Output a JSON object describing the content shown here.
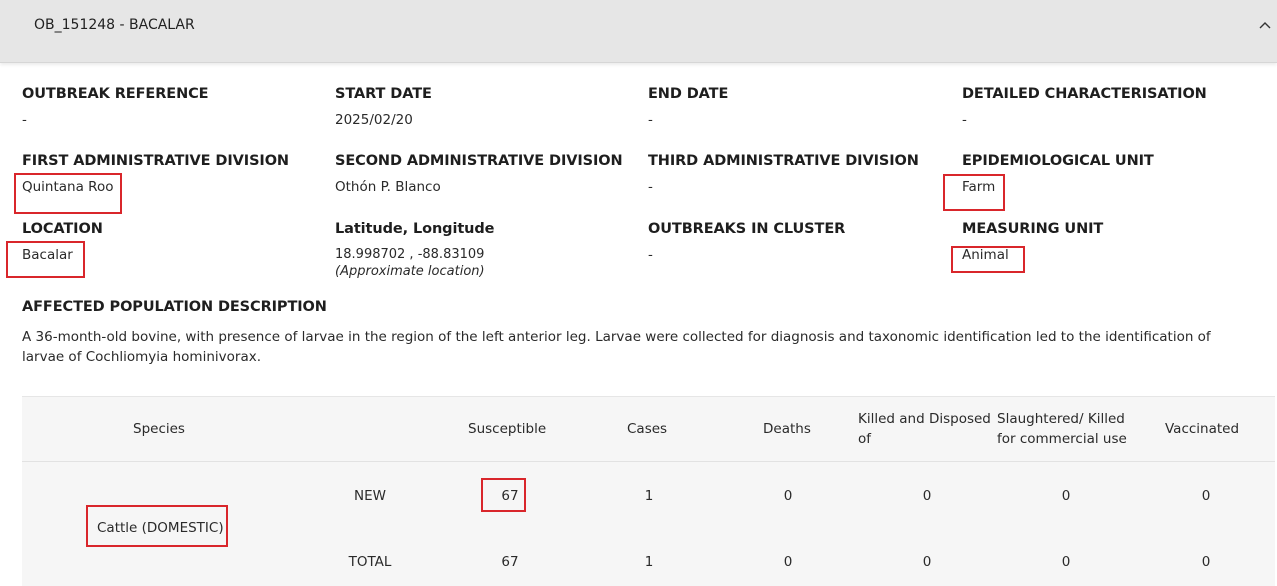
{
  "header": {
    "title": "OB_151248 - BACALAR",
    "toggle_icon": "chevron-up-icon"
  },
  "fields": {
    "outbreak_reference": {
      "label": "OUTBREAK REFERENCE",
      "value": "-"
    },
    "start_date": {
      "label": "START DATE",
      "value": "2025/02/20"
    },
    "end_date": {
      "label": "END DATE",
      "value": "-"
    },
    "detailed_characterisation": {
      "label": "DETAILED CHARACTERISATION",
      "value": "-"
    },
    "first_admin_division": {
      "label": "FIRST ADMINISTRATIVE DIVISION",
      "value": "Quintana Roo"
    },
    "second_admin_division": {
      "label": "SECOND ADMINISTRATIVE DIVISION",
      "value": "Othón P. Blanco"
    },
    "third_admin_division": {
      "label": "THIRD ADMINISTRATIVE DIVISION",
      "value": "-"
    },
    "epidemiological_unit": {
      "label": "EPIDEMIOLOGICAL UNIT",
      "value": "Farm"
    },
    "location": {
      "label": "LOCATION",
      "value": "Bacalar"
    },
    "lat_long": {
      "label": "Latitude, Longitude",
      "value": "18.998702 , -88.83109",
      "note": "(Approximate location)"
    },
    "outbreaks_in_cluster": {
      "label": "OUTBREAKS IN CLUSTER",
      "value": "-"
    },
    "measuring_unit": {
      "label": "MEASURING UNIT",
      "value": "Animal"
    }
  },
  "affected_population": {
    "label": "AFFECTED POPULATION DESCRIPTION",
    "text": "A 36-month-old bovine, with presence of larvae in the region of the left anterior leg. Larvae were collected for diagnosis and taxonomic identification led to the identification of larvae of Cochliomyia hominivorax."
  },
  "table": {
    "headers": {
      "species": "Species",
      "susceptible": "Susceptible",
      "cases": "Cases",
      "deaths": "Deaths",
      "killed_l1": "Killed and Disposed",
      "killed_l2": "of",
      "slaughtered_l1": "Slaughtered/ Killed",
      "slaughtered_l2": "for commercial use",
      "vaccinated": "Vaccinated"
    },
    "species": "Cattle (DOMESTIC)",
    "rows": [
      {
        "type": "NEW",
        "susceptible": "67",
        "cases": "1",
        "deaths": "0",
        "killed": "0",
        "slaughtered": "0",
        "vaccinated": "0"
      },
      {
        "type": "TOTAL",
        "susceptible": "67",
        "cases": "1",
        "deaths": "0",
        "killed": "0",
        "slaughtered": "0",
        "vaccinated": "0"
      }
    ]
  },
  "highlight_color": "#d9262b"
}
